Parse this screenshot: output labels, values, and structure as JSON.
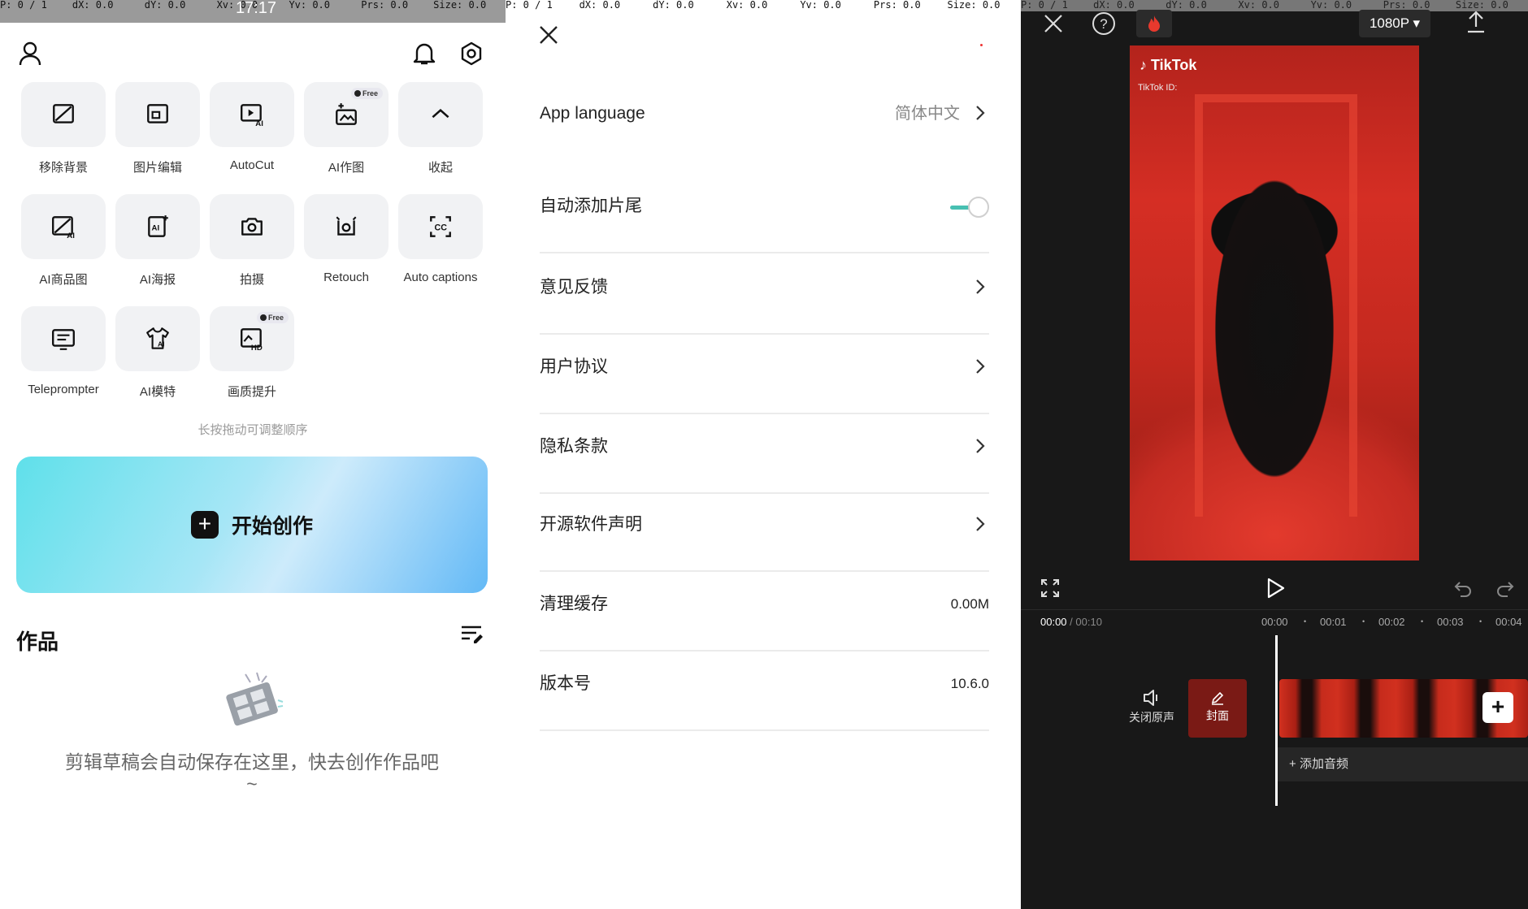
{
  "debug": {
    "p1": [
      "P: 0 / 1",
      "dX: 0.0",
      "dY: 0.0",
      "Xv: 0.0",
      "Yv: 0.0",
      "Prs: 0.0",
      "Size: 0.0"
    ],
    "p2": [
      "P: 0 / 1",
      "dX: 0.0",
      "dY: 0.0",
      "Xv: 0.0",
      "Yv: 0.0",
      "Prs: 0.0",
      "Size: 0.0"
    ],
    "p3": [
      "P: 0 / 1",
      "dX: 0.0",
      "dY: 0.0",
      "Xv: 0.0",
      "Yv: 0.0",
      "Prs: 0.0",
      "Size: 0.0"
    ],
    "clock": "17:17"
  },
  "home": {
    "tools": [
      {
        "label": "移除背景",
        "icon": "remove-bg-icon"
      },
      {
        "label": "图片编辑",
        "icon": "image-edit-icon"
      },
      {
        "label": "AutoCut",
        "icon": "autocut-icon"
      },
      {
        "label": "AI作图",
        "icon": "ai-image-icon",
        "badge": "Free"
      },
      {
        "label": "收起",
        "icon": "chevron-up-icon"
      },
      {
        "label": "AI商品图",
        "icon": "ai-product-icon"
      },
      {
        "label": "AI海报",
        "icon": "ai-poster-icon"
      },
      {
        "label": "拍摄",
        "icon": "camera-icon"
      },
      {
        "label": "Retouch",
        "icon": "retouch-icon"
      },
      {
        "label": "Auto captions",
        "icon": "captions-icon"
      },
      {
        "label": "Teleprompter",
        "icon": "teleprompter-icon"
      },
      {
        "label": "AI模特",
        "icon": "ai-model-icon"
      },
      {
        "label": "画质提升",
        "icon": "hd-enhance-icon",
        "badge": "Free"
      }
    ],
    "hint": "长按拖动可调整顺序",
    "create_label": "开始创作",
    "works_title": "作品",
    "empty_text": "剪辑草稿会自动保存在这里，快去创作作品吧~"
  },
  "settings": {
    "rows": [
      {
        "label": "App language",
        "value": "简体中文",
        "type": "link"
      },
      {
        "label": "自动添加片尾",
        "type": "toggle",
        "on": true
      },
      {
        "label": "意见反馈",
        "type": "link"
      },
      {
        "label": "用户协议",
        "type": "link"
      },
      {
        "label": "隐私条款",
        "type": "link"
      },
      {
        "label": "开源软件声明",
        "type": "link"
      },
      {
        "label": "清理缓存",
        "value": "0.00M",
        "type": "value"
      },
      {
        "label": "版本号",
        "value": "10.6.0",
        "type": "value"
      }
    ]
  },
  "editor": {
    "resolution": "1080P",
    "video_brand": "TikTok",
    "video_id_label": "TikTok ID:",
    "time_current": "00:00",
    "time_total": "/ 00:10",
    "ticks": [
      "00:00",
      "00:01",
      "00:02",
      "00:03",
      "00:04"
    ],
    "mute_label": "关闭原声",
    "cover_label": "封面",
    "add_audio": "添加音频"
  },
  "colors": {
    "toggle_on": "#48c0b2",
    "editor_bg": "#181818"
  }
}
